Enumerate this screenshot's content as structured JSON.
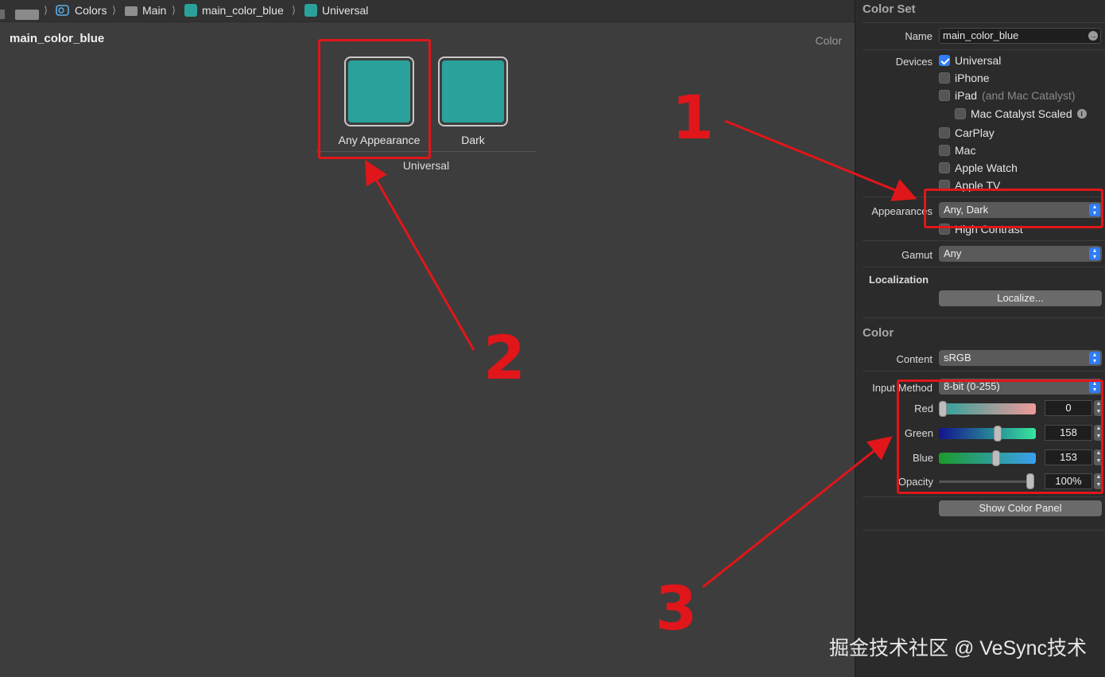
{
  "breadcrumbs": [
    {
      "label": "Colors",
      "icon": "asset-catalog-icon"
    },
    {
      "label": "Main",
      "icon": "folder-icon"
    },
    {
      "label": "main_color_blue",
      "icon": "color-swatch-icon"
    },
    {
      "label": "Universal",
      "icon": "color-swatch-icon"
    }
  ],
  "editor": {
    "title": "main_color_blue",
    "kind": "Color",
    "swatches": [
      {
        "label": "Any Appearance",
        "color": "#2aa29b"
      },
      {
        "label": "Dark",
        "color": "#2aa29b"
      }
    ],
    "group_label": "Universal"
  },
  "inspector": {
    "color_set_title": "Color Set",
    "name_label": "Name",
    "name_value": "main_color_blue",
    "devices_label": "Devices",
    "devices": [
      {
        "label": "Universal",
        "checked": true
      },
      {
        "label": "iPhone",
        "checked": false
      },
      {
        "label": "iPad",
        "suffix": "(and Mac Catalyst)",
        "checked": false
      },
      {
        "label": "Mac Catalyst Scaled",
        "checked": false
      },
      {
        "label": "CarPlay",
        "checked": false
      },
      {
        "label": "Mac",
        "checked": false
      },
      {
        "label": "Apple Watch",
        "checked": false
      },
      {
        "label": "Apple TV",
        "checked": false
      }
    ],
    "appearances_label": "Appearances",
    "appearances_value": "Any, Dark",
    "high_contrast_label": "High Contrast",
    "gamut_label": "Gamut",
    "gamut_value": "Any",
    "localization_label": "Localization",
    "localize_button": "Localize...",
    "color_title": "Color",
    "content_label": "Content",
    "content_value": "sRGB",
    "input_method_label": "Input Method",
    "input_method_value": "8-bit (0-255)",
    "sliders": [
      {
        "label": "Red",
        "value": "0",
        "level": 0.0
      },
      {
        "label": "Green",
        "value": "158",
        "level": 0.62
      },
      {
        "label": "Blue",
        "value": "153",
        "level": 0.6
      }
    ],
    "opacity_label": "Opacity",
    "opacity_value": "100%",
    "opacity_level": 1.0,
    "show_color_panel_button": "Show Color Panel"
  },
  "annotations": {
    "numbers": [
      "1",
      "2",
      "3"
    ],
    "color": "#e0161a"
  },
  "watermark": "掘金技术社区 @ VeSync技术"
}
